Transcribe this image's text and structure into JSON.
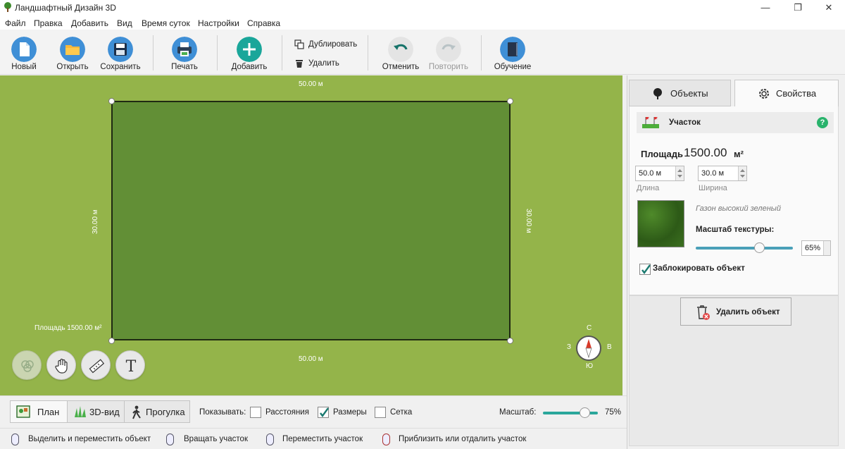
{
  "window": {
    "title": "Ландшафтный Дизайн 3D",
    "minimize": "—",
    "maximize": "❐",
    "close": "✕"
  },
  "menu": [
    "Файл",
    "Правка",
    "Добавить",
    "Вид",
    "Время суток",
    "Настройки",
    "Справка"
  ],
  "toolbar": {
    "new": "Новый",
    "open": "Открыть",
    "save": "Сохранить",
    "print": "Печать",
    "add": "Добавить",
    "duplicate": "Дублировать",
    "delete": "Удалить",
    "undo": "Отменить",
    "redo": "Повторить",
    "tutorial": "Обучение"
  },
  "canvas": {
    "dim_top": "50.00 м",
    "dim_bottom": "50.00 м",
    "dim_left": "30.00 м",
    "dim_right": "30.00 м",
    "area_label": "Площадь 1500.00 м²",
    "compass": {
      "n": "С",
      "s": "Ю",
      "w": "З",
      "e": "В"
    }
  },
  "tabs": {
    "objects": "Объекты",
    "properties": "Свойства"
  },
  "properties": {
    "object_name": "Участок",
    "help": "?",
    "area_label": "Площадь",
    "area_value": "1500.00",
    "area_unit": "м²",
    "length_value": "50.0 м",
    "length_label": "Длина",
    "width_value": "30.0 м",
    "width_label": "Ширина",
    "texture_name": "Газон высокий зеленый",
    "texture_scale_label": "Масштаб текстуры:",
    "texture_scale_value": "65%",
    "texture_scale_fraction": 0.65,
    "lock_label": "Заблокировать объект",
    "lock_checked": true,
    "delete_button": "Удалить объект"
  },
  "viewbar": {
    "plan": "План",
    "view3d": "3D-вид",
    "walk": "Прогулка",
    "show_label": "Показывать:",
    "distances": "Расстояния",
    "distances_checked": false,
    "dimensions": "Размеры",
    "dimensions_checked": true,
    "grid": "Сетка",
    "grid_checked": false,
    "scale_label": "Масштаб:",
    "scale_value": "75%",
    "scale_fraction": 0.75
  },
  "hints": [
    "Выделить и переместить объект",
    "Вращать участок",
    "Переместить участок",
    "Приблизить или отдалить участок"
  ],
  "colors": {
    "grass_bg": "#94b44a",
    "plot_fill": "#628f36",
    "accent": "#1aa69a",
    "help": "#29b36c"
  }
}
